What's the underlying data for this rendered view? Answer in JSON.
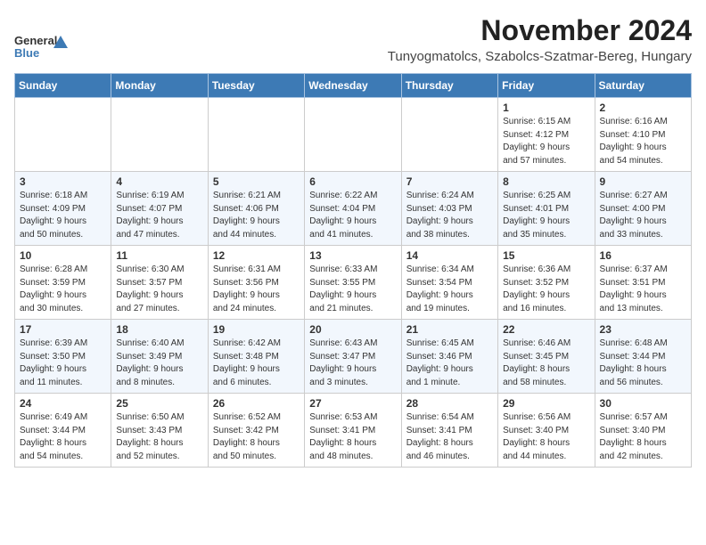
{
  "header": {
    "logo_line1": "General",
    "logo_line2": "Blue",
    "month": "November 2024",
    "location": "Tunyogmatolcs, Szabolcs-Szatmar-Bereg, Hungary"
  },
  "weekdays": [
    "Sunday",
    "Monday",
    "Tuesday",
    "Wednesday",
    "Thursday",
    "Friday",
    "Saturday"
  ],
  "weeks": [
    [
      {
        "day": "",
        "info": ""
      },
      {
        "day": "",
        "info": ""
      },
      {
        "day": "",
        "info": ""
      },
      {
        "day": "",
        "info": ""
      },
      {
        "day": "",
        "info": ""
      },
      {
        "day": "1",
        "info": "Sunrise: 6:15 AM\nSunset: 4:12 PM\nDaylight: 9 hours\nand 57 minutes."
      },
      {
        "day": "2",
        "info": "Sunrise: 6:16 AM\nSunset: 4:10 PM\nDaylight: 9 hours\nand 54 minutes."
      }
    ],
    [
      {
        "day": "3",
        "info": "Sunrise: 6:18 AM\nSunset: 4:09 PM\nDaylight: 9 hours\nand 50 minutes."
      },
      {
        "day": "4",
        "info": "Sunrise: 6:19 AM\nSunset: 4:07 PM\nDaylight: 9 hours\nand 47 minutes."
      },
      {
        "day": "5",
        "info": "Sunrise: 6:21 AM\nSunset: 4:06 PM\nDaylight: 9 hours\nand 44 minutes."
      },
      {
        "day": "6",
        "info": "Sunrise: 6:22 AM\nSunset: 4:04 PM\nDaylight: 9 hours\nand 41 minutes."
      },
      {
        "day": "7",
        "info": "Sunrise: 6:24 AM\nSunset: 4:03 PM\nDaylight: 9 hours\nand 38 minutes."
      },
      {
        "day": "8",
        "info": "Sunrise: 6:25 AM\nSunset: 4:01 PM\nDaylight: 9 hours\nand 35 minutes."
      },
      {
        "day": "9",
        "info": "Sunrise: 6:27 AM\nSunset: 4:00 PM\nDaylight: 9 hours\nand 33 minutes."
      }
    ],
    [
      {
        "day": "10",
        "info": "Sunrise: 6:28 AM\nSunset: 3:59 PM\nDaylight: 9 hours\nand 30 minutes."
      },
      {
        "day": "11",
        "info": "Sunrise: 6:30 AM\nSunset: 3:57 PM\nDaylight: 9 hours\nand 27 minutes."
      },
      {
        "day": "12",
        "info": "Sunrise: 6:31 AM\nSunset: 3:56 PM\nDaylight: 9 hours\nand 24 minutes."
      },
      {
        "day": "13",
        "info": "Sunrise: 6:33 AM\nSunset: 3:55 PM\nDaylight: 9 hours\nand 21 minutes."
      },
      {
        "day": "14",
        "info": "Sunrise: 6:34 AM\nSunset: 3:54 PM\nDaylight: 9 hours\nand 19 minutes."
      },
      {
        "day": "15",
        "info": "Sunrise: 6:36 AM\nSunset: 3:52 PM\nDaylight: 9 hours\nand 16 minutes."
      },
      {
        "day": "16",
        "info": "Sunrise: 6:37 AM\nSunset: 3:51 PM\nDaylight: 9 hours\nand 13 minutes."
      }
    ],
    [
      {
        "day": "17",
        "info": "Sunrise: 6:39 AM\nSunset: 3:50 PM\nDaylight: 9 hours\nand 11 minutes."
      },
      {
        "day": "18",
        "info": "Sunrise: 6:40 AM\nSunset: 3:49 PM\nDaylight: 9 hours\nand 8 minutes."
      },
      {
        "day": "19",
        "info": "Sunrise: 6:42 AM\nSunset: 3:48 PM\nDaylight: 9 hours\nand 6 minutes."
      },
      {
        "day": "20",
        "info": "Sunrise: 6:43 AM\nSunset: 3:47 PM\nDaylight: 9 hours\nand 3 minutes."
      },
      {
        "day": "21",
        "info": "Sunrise: 6:45 AM\nSunset: 3:46 PM\nDaylight: 9 hours\nand 1 minute."
      },
      {
        "day": "22",
        "info": "Sunrise: 6:46 AM\nSunset: 3:45 PM\nDaylight: 8 hours\nand 58 minutes."
      },
      {
        "day": "23",
        "info": "Sunrise: 6:48 AM\nSunset: 3:44 PM\nDaylight: 8 hours\nand 56 minutes."
      }
    ],
    [
      {
        "day": "24",
        "info": "Sunrise: 6:49 AM\nSunset: 3:44 PM\nDaylight: 8 hours\nand 54 minutes."
      },
      {
        "day": "25",
        "info": "Sunrise: 6:50 AM\nSunset: 3:43 PM\nDaylight: 8 hours\nand 52 minutes."
      },
      {
        "day": "26",
        "info": "Sunrise: 6:52 AM\nSunset: 3:42 PM\nDaylight: 8 hours\nand 50 minutes."
      },
      {
        "day": "27",
        "info": "Sunrise: 6:53 AM\nSunset: 3:41 PM\nDaylight: 8 hours\nand 48 minutes."
      },
      {
        "day": "28",
        "info": "Sunrise: 6:54 AM\nSunset: 3:41 PM\nDaylight: 8 hours\nand 46 minutes."
      },
      {
        "day": "29",
        "info": "Sunrise: 6:56 AM\nSunset: 3:40 PM\nDaylight: 8 hours\nand 44 minutes."
      },
      {
        "day": "30",
        "info": "Sunrise: 6:57 AM\nSunset: 3:40 PM\nDaylight: 8 hours\nand 42 minutes."
      }
    ]
  ]
}
